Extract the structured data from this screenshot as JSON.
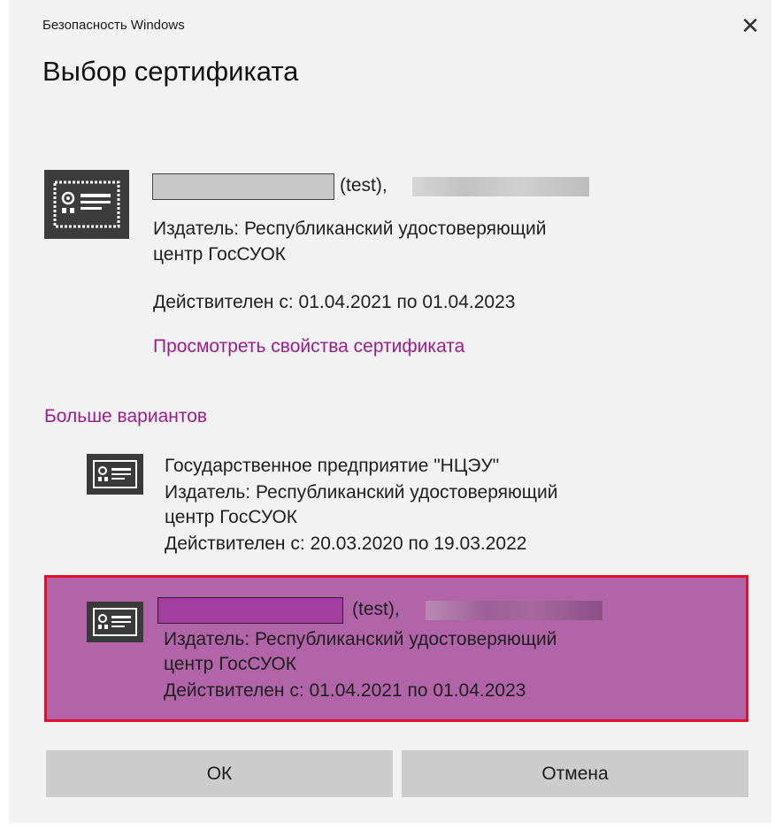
{
  "window": {
    "title": "Безопасность Windows",
    "close_glyph": "✕"
  },
  "heading": "Выбор сертификата",
  "primary_cert": {
    "icon": "certificate-icon",
    "name_suffix": "(test),",
    "issuer_line1": "Издатель: Республиканский удостоверяющий",
    "issuer_line2": "центр ГосСУОК",
    "validity": "Действителен с: 01.04.2021 по 01.04.2023",
    "view_link": "Просмотреть свойства сертификата"
  },
  "more_options_label": "Больше вариантов",
  "options": [
    {
      "icon": "certificate-icon",
      "name": "Государственное предприятие \"НЦЭУ\"",
      "issuer_line1": "Издатель: Республиканский удостоверяющий",
      "issuer_line2": "центр ГосСУОК",
      "validity": "Действителен с: 20.03.2020 по 19.03.2022",
      "selected": false
    },
    {
      "icon": "certificate-icon",
      "name_suffix": "(test),",
      "issuer_line1": "Издатель: Республиканский удостоверяющий",
      "issuer_line2": "центр ГосСУОК",
      "validity": "Действителен с: 01.04.2021 по 01.04.2023",
      "selected": true
    }
  ],
  "buttons": {
    "ok": "ОК",
    "cancel": "Отмена"
  },
  "colors": {
    "accent_link": "#9b1d8c",
    "selection_fill": "#b164a8",
    "selection_border": "#e2102a",
    "button_bg": "#cccccc",
    "dialog_bg": "#f2f2f2"
  }
}
